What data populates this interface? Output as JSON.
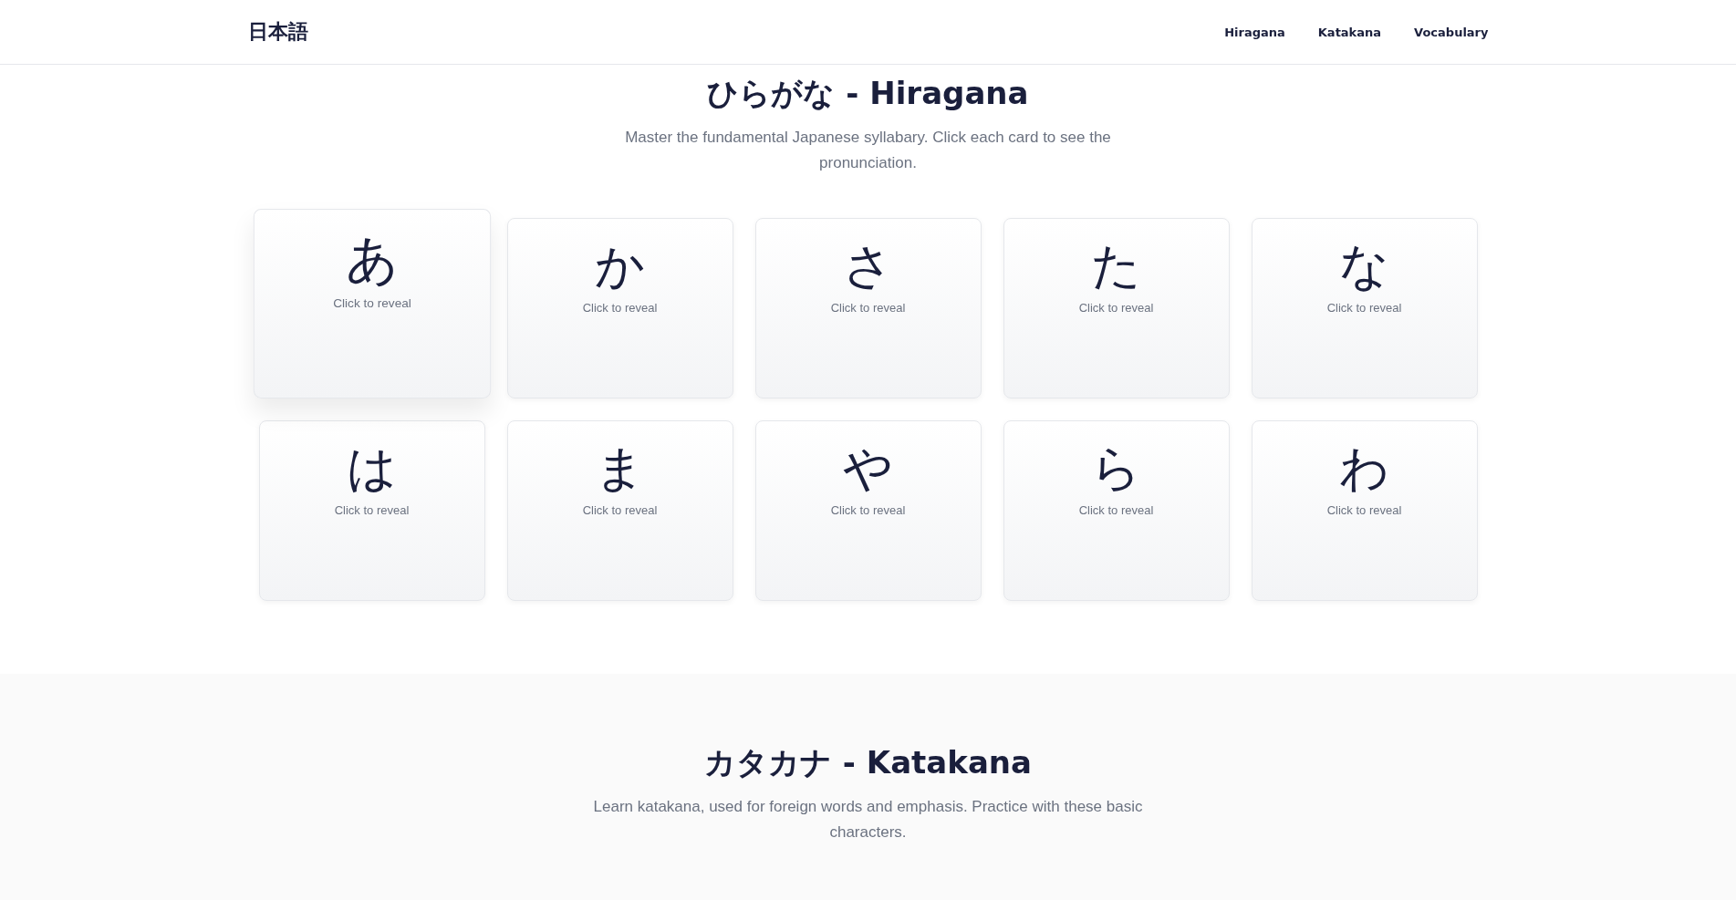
{
  "header": {
    "logo": "日本語",
    "nav": [
      {
        "label": "Hiragana"
      },
      {
        "label": "Katakana"
      },
      {
        "label": "Vocabulary"
      }
    ]
  },
  "sections": [
    {
      "title": "ひらがな - Hiragana",
      "subtitle": "Master the fundamental Japanese syllabary. Click each card to see the pronunciation.",
      "cards": [
        {
          "char": "あ",
          "hint": "Click to reveal",
          "hovered": true
        },
        {
          "char": "か",
          "hint": "Click to reveal",
          "hovered": false
        },
        {
          "char": "さ",
          "hint": "Click to reveal",
          "hovered": false
        },
        {
          "char": "た",
          "hint": "Click to reveal",
          "hovered": false
        },
        {
          "char": "な",
          "hint": "Click to reveal",
          "hovered": false
        },
        {
          "char": "は",
          "hint": "Click to reveal",
          "hovered": false
        },
        {
          "char": "ま",
          "hint": "Click to reveal",
          "hovered": false
        },
        {
          "char": "や",
          "hint": "Click to reveal",
          "hovered": false
        },
        {
          "char": "ら",
          "hint": "Click to reveal",
          "hovered": false
        },
        {
          "char": "わ",
          "hint": "Click to reveal",
          "hovered": false
        }
      ]
    },
    {
      "title": "カタカナ - Katakana",
      "subtitle": "Learn katakana, used for foreign words and emphasis. Practice with these basic characters."
    }
  ]
}
